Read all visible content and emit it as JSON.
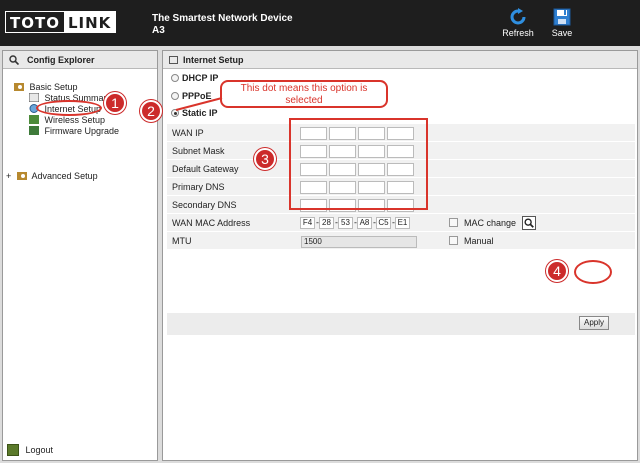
{
  "header": {
    "logo_part1": "TOTO",
    "logo_part2": "LINK",
    "tagline": "The Smartest Network Device",
    "model": "A3",
    "refresh_label": "Refresh",
    "save_label": "Save",
    "refresh_icon": "refresh-icon",
    "save_icon": "save-icon"
  },
  "sidebar": {
    "title": "Config Explorer",
    "basic_setup": "Basic Setup",
    "items": [
      {
        "label": "Status Summary"
      },
      {
        "label": "Internet Setup"
      },
      {
        "label": "Wireless Setup"
      },
      {
        "label": "Firmware Upgrade"
      }
    ],
    "advanced_setup": "Advanced Setup",
    "logout": "Logout"
  },
  "main": {
    "title": "Internet Setup",
    "radios": [
      {
        "label": "DHCP IP",
        "selected": false
      },
      {
        "label": "PPPoE",
        "selected": false
      },
      {
        "label": "Static IP",
        "selected": true
      }
    ],
    "fields": {
      "wan_ip": "WAN IP",
      "subnet_mask": "Subnet Mask",
      "default_gateway": "Default Gateway",
      "primary_dns": "Primary DNS",
      "secondary_dns": "Secondary DNS",
      "wan_mac": "WAN MAC Address",
      "mtu": "MTU"
    },
    "mac_values": [
      "F4",
      "28",
      "53",
      "A8",
      "C5",
      "E1"
    ],
    "mtu_value": "1500",
    "mac_change_label": "MAC change",
    "manual_label": "Manual",
    "apply_label": "Apply"
  },
  "annotations": {
    "callout_text": "This dot means this option is selected",
    "n1": "1",
    "n2": "2",
    "n3": "3",
    "n4": "4",
    "color": "#d9342b"
  }
}
